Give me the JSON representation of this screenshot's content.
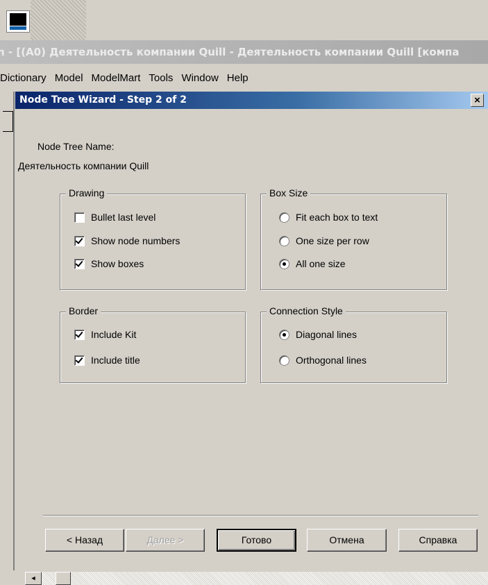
{
  "app": {
    "title": "n - [(A0) Деятельность компании Quill - Деятельность компании Quill  [компа",
    "menu": [
      "Dictionary",
      "Model",
      "ModelMart",
      "Tools",
      "Window",
      "Help"
    ]
  },
  "dialog": {
    "title": "Node Tree Wizard - Step 2 of 2",
    "close": "×",
    "node_tree_name_label": "Node Tree Name:",
    "node_tree_name_value": "Деятельность компании Quill",
    "drawing": {
      "legend": "Drawing",
      "bullet_last_level": {
        "label": "Bullet last level",
        "checked": false
      },
      "show_node_numbers": {
        "label": "Show node numbers",
        "checked": true
      },
      "show_boxes": {
        "label": "Show boxes",
        "checked": true
      }
    },
    "box_size": {
      "legend": "Box Size",
      "fit_each": {
        "label": "Fit each box to text",
        "selected": false
      },
      "one_per_row": {
        "label": "One size per row",
        "selected": false
      },
      "all_one": {
        "label": "All one size",
        "selected": true
      }
    },
    "border": {
      "legend": "Border",
      "include_kit": {
        "label": "Include Kit",
        "checked": true
      },
      "include_title": {
        "label": "Include title",
        "checked": true
      }
    },
    "connection_style": {
      "legend": "Connection Style",
      "diagonal": {
        "label": "Diagonal lines",
        "selected": true
      },
      "orthogonal": {
        "label": "Orthogonal lines",
        "selected": false
      }
    },
    "buttons": {
      "back": "< Назад",
      "next": "Далее >",
      "finish": "Готово",
      "cancel": "Отмена",
      "help": "Справка"
    }
  },
  "scrollbar": {
    "left_arrow": "◄"
  }
}
